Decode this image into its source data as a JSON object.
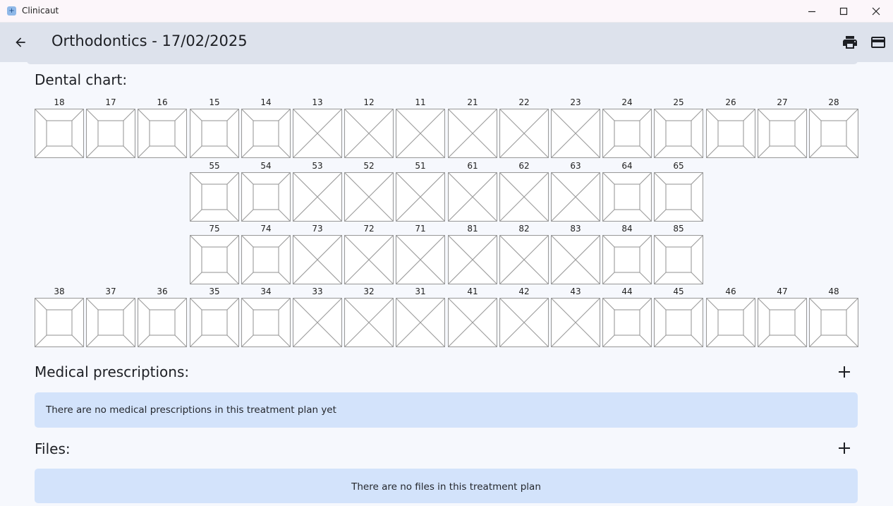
{
  "window": {
    "app_name": "Clinicaut"
  },
  "header": {
    "title": "Orthodontics - 17/02/2025"
  },
  "dental_chart": {
    "title": "Dental chart:",
    "rows": [
      {
        "offset": 0,
        "teeth": [
          {
            "num": "18",
            "status": "present"
          },
          {
            "num": "17",
            "status": "present"
          },
          {
            "num": "16",
            "status": "present"
          },
          {
            "num": "15",
            "status": "present"
          },
          {
            "num": "14",
            "status": "present"
          },
          {
            "num": "13",
            "status": "crossed"
          },
          {
            "num": "12",
            "status": "crossed"
          },
          {
            "num": "11",
            "status": "crossed"
          },
          {
            "num": "21",
            "status": "crossed"
          },
          {
            "num": "22",
            "status": "crossed"
          },
          {
            "num": "23",
            "status": "crossed"
          },
          {
            "num": "24",
            "status": "present"
          },
          {
            "num": "25",
            "status": "present"
          },
          {
            "num": "26",
            "status": "present"
          },
          {
            "num": "27",
            "status": "present"
          },
          {
            "num": "28",
            "status": "present"
          }
        ]
      },
      {
        "offset": 3,
        "teeth": [
          {
            "num": "55",
            "status": "present"
          },
          {
            "num": "54",
            "status": "present"
          },
          {
            "num": "53",
            "status": "crossed"
          },
          {
            "num": "52",
            "status": "crossed"
          },
          {
            "num": "51",
            "status": "crossed"
          },
          {
            "num": "61",
            "status": "crossed"
          },
          {
            "num": "62",
            "status": "crossed"
          },
          {
            "num": "63",
            "status": "crossed"
          },
          {
            "num": "64",
            "status": "present"
          },
          {
            "num": "65",
            "status": "present"
          }
        ]
      },
      {
        "offset": 3,
        "teeth": [
          {
            "num": "75",
            "status": "present"
          },
          {
            "num": "74",
            "status": "present"
          },
          {
            "num": "73",
            "status": "crossed"
          },
          {
            "num": "72",
            "status": "crossed"
          },
          {
            "num": "71",
            "status": "crossed"
          },
          {
            "num": "81",
            "status": "crossed"
          },
          {
            "num": "82",
            "status": "crossed"
          },
          {
            "num": "83",
            "status": "crossed"
          },
          {
            "num": "84",
            "status": "present"
          },
          {
            "num": "85",
            "status": "present"
          }
        ]
      },
      {
        "offset": 0,
        "teeth": [
          {
            "num": "38",
            "status": "present"
          },
          {
            "num": "37",
            "status": "present"
          },
          {
            "num": "36",
            "status": "present"
          },
          {
            "num": "35",
            "status": "present"
          },
          {
            "num": "34",
            "status": "present"
          },
          {
            "num": "33",
            "status": "crossed"
          },
          {
            "num": "32",
            "status": "crossed"
          },
          {
            "num": "31",
            "status": "crossed"
          },
          {
            "num": "41",
            "status": "crossed"
          },
          {
            "num": "42",
            "status": "crossed"
          },
          {
            "num": "43",
            "status": "crossed"
          },
          {
            "num": "44",
            "status": "present"
          },
          {
            "num": "45",
            "status": "present"
          },
          {
            "num": "46",
            "status": "present"
          },
          {
            "num": "47",
            "status": "present"
          },
          {
            "num": "48",
            "status": "present"
          }
        ]
      }
    ]
  },
  "prescriptions": {
    "title": "Medical prescriptions:",
    "empty_text": "There are no medical prescriptions in this treatment plan yet"
  },
  "files": {
    "title": "Files:",
    "empty_text": "There are no files in this treatment plan"
  },
  "icons": {
    "app": "app-icon",
    "minimize": "minimize-icon",
    "maximize": "maximize-icon",
    "close": "close-icon",
    "back": "arrow-back-icon",
    "print": "print-icon",
    "card": "credit-card-icon",
    "add": "plus-icon"
  },
  "colors": {
    "header_bg": "#dde2ec",
    "page_bg": "#f6f8fd",
    "info_box_bg": "#d3e3fb",
    "tooth_stroke": "#9a9a9a"
  }
}
